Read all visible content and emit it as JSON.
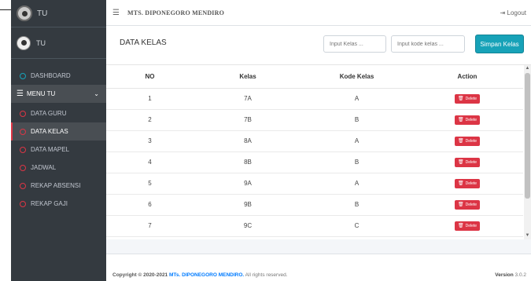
{
  "sidebar": {
    "brand_text": "TU",
    "user_name": "TU",
    "items": [
      {
        "label": "DASHBOARD"
      },
      {
        "label": "MENU TU"
      },
      {
        "label": "DATA GURU"
      },
      {
        "label": "DATA KELAS"
      },
      {
        "label": "DATA MAPEL"
      },
      {
        "label": "JADWAL"
      },
      {
        "label": "REKAP ABSENSI"
      },
      {
        "label": "REKAP GAJI"
      }
    ]
  },
  "topbar": {
    "title": "MTS. DIPONEGORO MENDIRO",
    "logout_label": "Logout"
  },
  "page": {
    "title": "DATA KELAS",
    "input_kelas_placeholder": "Input Kelas ...",
    "input_kode_placeholder": "Input kode kelas ...",
    "save_label": "Simpan Kelas"
  },
  "table": {
    "headers": [
      "NO",
      "Kelas",
      "Kode Kelas",
      "Action"
    ],
    "delete_label": "Delete",
    "rows": [
      [
        "1",
        "7A",
        "A"
      ],
      [
        "2",
        "7B",
        "B"
      ],
      [
        "3",
        "8A",
        "A"
      ],
      [
        "4",
        "8B",
        "B"
      ],
      [
        "5",
        "9A",
        "A"
      ],
      [
        "6",
        "9B",
        "B"
      ],
      [
        "7",
        "9C",
        "C"
      ]
    ]
  },
  "footer": {
    "copyright_prefix": "Copyright © 2020-2021",
    "brand": "MTs. DIPONEGORO MENDIRO.",
    "rights": "All rights reserved.",
    "version_label": "Version",
    "version_number": "3.0.2"
  },
  "colors": {
    "sidebar_bg": "#343a40",
    "accent_info": "#17a2b8",
    "danger": "#dc3545",
    "link": "#007bff"
  }
}
